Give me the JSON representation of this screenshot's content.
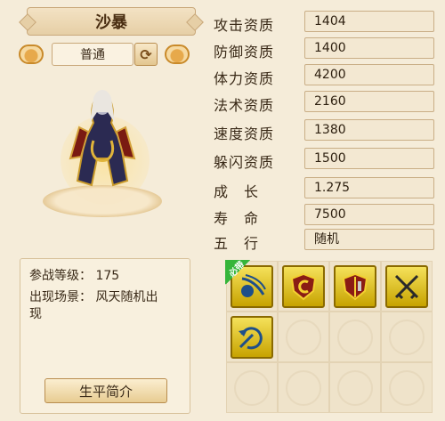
{
  "pet": {
    "name": "沙暴",
    "variant": "普通"
  },
  "stats": [
    {
      "label": "攻击资质",
      "value": "1404"
    },
    {
      "label": "防御资质",
      "value": "1400"
    },
    {
      "label": "体力资质",
      "value": "4200"
    },
    {
      "label": "法术资质",
      "value": "2160"
    },
    {
      "label": "速度资质",
      "value": "1380"
    },
    {
      "label": "躲闪资质",
      "value": "1500"
    },
    {
      "label": "成长",
      "value": "1.275"
    },
    {
      "label": "寿命",
      "value": "7500"
    },
    {
      "label": "五行",
      "value": "随机"
    }
  ],
  "info": {
    "level_label": "参战等级：",
    "level_value": "175",
    "scene_label": "出现场景：",
    "scene_value": "风天随机出",
    "scene_value_cont": "现",
    "bio_button": "生平简介"
  },
  "skills": {
    "must_badge": "必带",
    "icons": [
      "whirl-skill-icon",
      "shield-c-skill-icon",
      "shield-b-skill-icon",
      "crossed-swords-skill-icon",
      "counter-strike-skill-icon"
    ],
    "icon_color": "#e8cf2a"
  }
}
